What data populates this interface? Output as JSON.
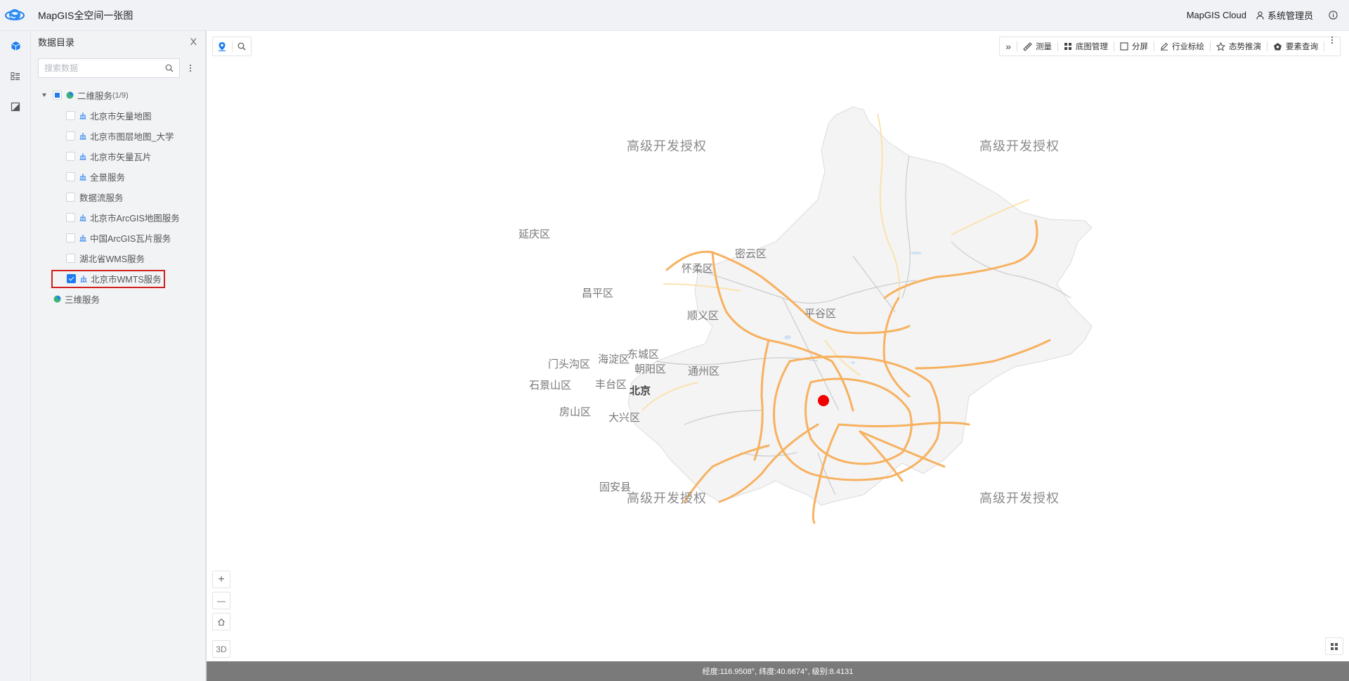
{
  "header": {
    "app_title": "MapGIS全空间一张图",
    "cloud_link": "MapGIS Cloud",
    "user_name": "系统管理员"
  },
  "panel": {
    "title": "数据目录",
    "close_label": "X",
    "search_placeholder": "搜索数据",
    "tree": {
      "group_2d": {
        "label": "二维服务",
        "count": "(1/9)"
      },
      "items": [
        {
          "label": "北京市矢量地图",
          "checked": false
        },
        {
          "label": "北京市图层地图_大学",
          "checked": false
        },
        {
          "label": "北京市矢量瓦片",
          "checked": false
        },
        {
          "label": "全景服务",
          "checked": false
        },
        {
          "label": "数据流服务",
          "checked": false
        },
        {
          "label": "北京市ArcGIS地图服务",
          "checked": false
        },
        {
          "label": "中国ArcGIS瓦片服务",
          "checked": false
        },
        {
          "label": "湖北省WMS服务",
          "checked": false
        },
        {
          "label": "北京市WMTS服务",
          "checked": true
        }
      ],
      "group_3d": {
        "label": "三维服务"
      }
    }
  },
  "toolbar": {
    "expand": "»",
    "measure": "测量",
    "basemap": "底图管理",
    "split": "分屏",
    "plot": "行业标绘",
    "situation": "态势推演",
    "feature_query": "要素查询"
  },
  "map": {
    "watermark": "高级开发授权",
    "labels": {
      "yanqing": "延庆区",
      "miyun": "密云区",
      "huairou": "怀柔区",
      "changping": "昌平区",
      "shunyi": "顺义区",
      "pinggu": "平谷区",
      "haidian": "海淀区",
      "dongcheng": "东城区",
      "mentougou": "门头沟区",
      "chaoyang": "朝阳区",
      "tongzhou": "通州区",
      "shijingshan": "石景山区",
      "fengtai": "丰台区",
      "beijing": "北京",
      "fangshan": "房山区",
      "daxing": "大兴区",
      "gu_an": "固安县"
    },
    "zoom_in": "+",
    "zoom_out": "—",
    "mode_3d": "3D"
  },
  "status": {
    "text": "经度:116.9508°, 纬度:40.6674°, 级别:8.4131"
  },
  "colors": {
    "accent": "#1e7cf2",
    "highlight_border": "#d0201f",
    "road": "#f7b160",
    "marker": "#f20000"
  }
}
